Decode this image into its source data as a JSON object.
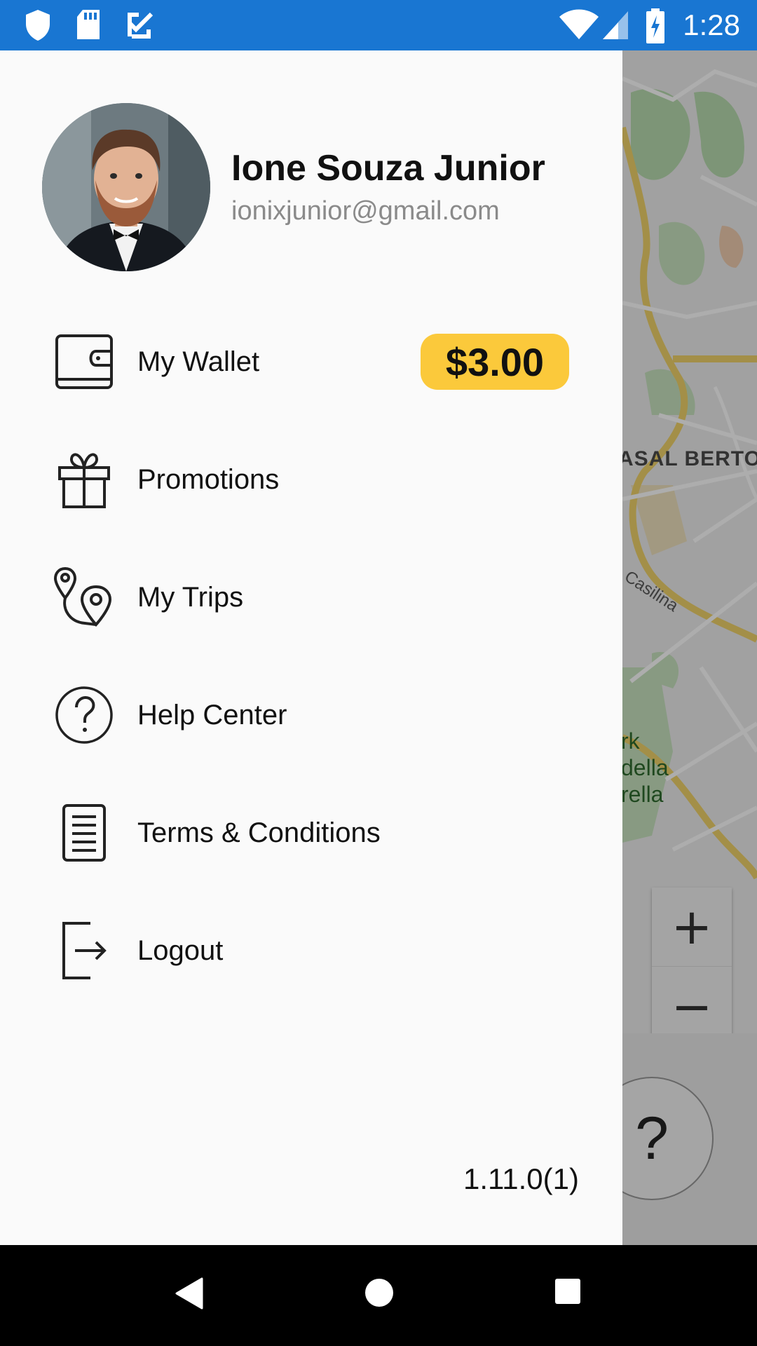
{
  "status_bar": {
    "time": "1:28",
    "left_icons": [
      "shield-icon",
      "sd-card-icon",
      "task-check-icon"
    ],
    "right_icons": [
      "wifi-icon",
      "cell-signal-icon",
      "battery-charging-icon"
    ],
    "background": "#1976d2"
  },
  "drawer": {
    "user": {
      "name": "Ione Souza Junior",
      "email": "ionixjunior@gmail.com"
    },
    "menu": [
      {
        "icon": "wallet-icon",
        "label": "My Wallet",
        "badge": "$3.00"
      },
      {
        "icon": "gift-icon",
        "label": "Promotions"
      },
      {
        "icon": "map-pins-icon",
        "label": "My Trips"
      },
      {
        "icon": "help-circle-icon",
        "label": "Help Center"
      },
      {
        "icon": "document-icon",
        "label": "Terms & Conditions"
      },
      {
        "icon": "logout-icon",
        "label": "Logout"
      }
    ],
    "version": "1.11.0(1)",
    "badge_color": "#fbc93b"
  },
  "map": {
    "labels": {
      "district": "ASAL BERTON",
      "street": "a Casilina",
      "park_line1": "rk",
      "park_line2": "della",
      "park_line3": "rella"
    },
    "zoom_in": "+",
    "zoom_out": "−",
    "help_button": "?"
  },
  "nav_bar": {
    "buttons": [
      "back-icon",
      "home-icon",
      "recents-icon"
    ]
  }
}
